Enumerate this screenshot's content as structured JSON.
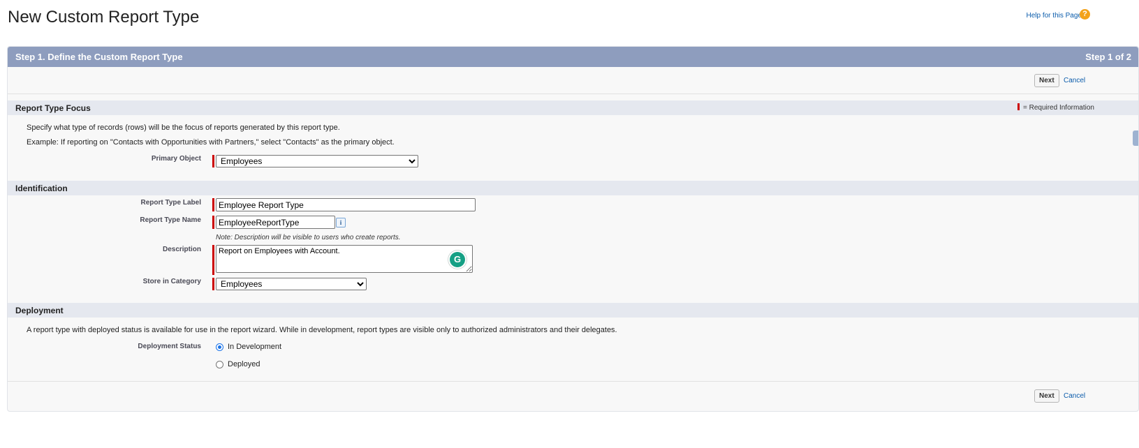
{
  "page": {
    "title": "New Custom Report Type",
    "help_link": "Help for this Page",
    "help_icon": "?"
  },
  "wizard": {
    "step_title": "Step 1. Define the Custom Report Type",
    "step_indicator": "Step 1 of 2",
    "next_label": "Next",
    "cancel_label": "Cancel"
  },
  "focus_section": {
    "title": "Report Type Focus",
    "required_legend": "= Required Information",
    "desc1": "Specify what type of records (rows) will be the focus of reports generated by this report type.",
    "desc2": "Example: If reporting on \"Contacts with Opportunities with Partners,\" select \"Contacts\" as the primary object.",
    "primary_object_label": "Primary Object",
    "primary_object_value": "Employees"
  },
  "identification": {
    "title": "Identification",
    "label_label": "Report Type Label",
    "label_value": "Employee Report Type",
    "name_label": "Report Type Name",
    "name_value": "EmployeeReportType",
    "info_icon": "i",
    "note": "Note: Description will be visible to users who create reports.",
    "description_label": "Description",
    "description_value": "Report on Employees with Account.",
    "grammarly_glyph": "G",
    "category_label": "Store in Category",
    "category_value": "Employees"
  },
  "deployment": {
    "title": "Deployment",
    "desc": "A report type with deployed status is available for use in the report wizard. While in development, report types are visible only to authorized administrators and their delegates.",
    "status_label": "Deployment Status",
    "option_in_development": "In Development",
    "option_deployed": "Deployed",
    "selected": "In Development"
  },
  "colors": {
    "header_bg": "#8e9dbe",
    "section_bg": "#e5e8ef",
    "required": "#cc0000",
    "link": "#0b5cab"
  }
}
